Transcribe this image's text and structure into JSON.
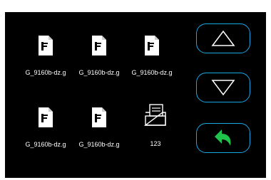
{
  "files": [
    {
      "name": "G_9160b-dz.g",
      "icon": "document-icon"
    },
    {
      "name": "G_9160b-dz.g",
      "icon": "document-icon"
    },
    {
      "name": "G_9160b-dz.g",
      "icon": "document-icon"
    },
    {
      "name": "G_9160b-dz.g",
      "icon": "document-icon"
    },
    {
      "name": "G_9160b-dz.g",
      "icon": "document-icon"
    },
    {
      "name": "123",
      "icon": "folder-icon"
    }
  ],
  "controls": {
    "up": {
      "icon": "triangle-up-icon"
    },
    "down": {
      "icon": "triangle-down-icon"
    },
    "back": {
      "icon": "return-arrow-icon",
      "color": "#1fc24a"
    }
  },
  "colors": {
    "background": "#000000",
    "button_border": "#1aa6e6",
    "text": "#ffffff"
  }
}
